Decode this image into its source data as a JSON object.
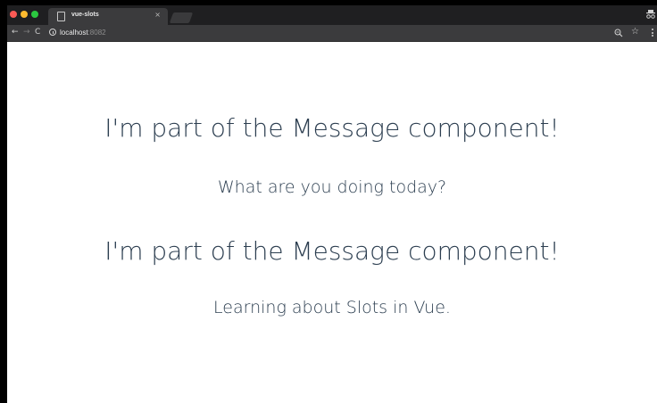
{
  "browser": {
    "tab_title": "vue-slots",
    "tab_close": "×",
    "url_host": "localhost",
    "url_port": ":8082",
    "icons": {
      "back": "arrow-left-icon",
      "forward": "arrow-right-icon",
      "reload": "reload-icon",
      "info": "info-icon",
      "zoom": "zoom-icon",
      "star": "star-icon",
      "menu": "menu-icon",
      "incognito": "incognito-icon",
      "page": "page-icon"
    },
    "colors": {
      "close": "#fc5a55",
      "minimize": "#fdbb2f",
      "maximize": "#2bc840",
      "chrome_dark": "#1f1f21",
      "tab_bg": "#3b3b3d"
    }
  },
  "page": {
    "text_color": "#2c3e50",
    "messages": [
      {
        "heading": "I'm part of the Message component!",
        "body": "What are you doing today?"
      },
      {
        "heading": "I'm part of the Message component!",
        "body": "Learning about Slots in Vue."
      }
    ]
  }
}
